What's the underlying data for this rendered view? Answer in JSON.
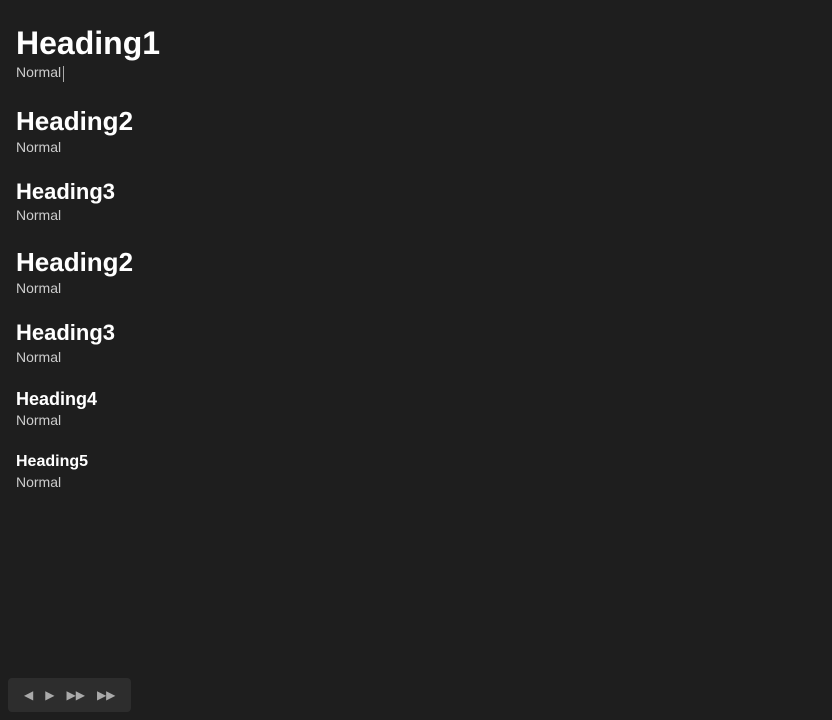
{
  "headings": [
    {
      "id": "heading1",
      "level": 1,
      "text": "Heading1",
      "normal_label": "Normal",
      "has_cursor": true
    },
    {
      "id": "heading2a",
      "level": 2,
      "text": "Heading2",
      "normal_label": "Normal",
      "has_cursor": false
    },
    {
      "id": "heading3a",
      "level": 3,
      "text": "Heading3",
      "normal_label": "Normal",
      "has_cursor": false
    },
    {
      "id": "heading2b",
      "level": 2,
      "text": "Heading2",
      "normal_label": "Normal",
      "has_cursor": false
    },
    {
      "id": "heading3b",
      "level": 3,
      "text": "Heading3",
      "normal_label": "Normal",
      "has_cursor": false
    },
    {
      "id": "heading4",
      "level": 4,
      "text": "Heading4",
      "normal_label": "Normal",
      "has_cursor": false
    },
    {
      "id": "heading5",
      "level": 5,
      "text": "Heading5",
      "normal_label": "Normal",
      "has_cursor": false
    }
  ],
  "toolbar": {
    "buttons": [
      "◀",
      "▶",
      "▶▶",
      "▶▶"
    ]
  }
}
